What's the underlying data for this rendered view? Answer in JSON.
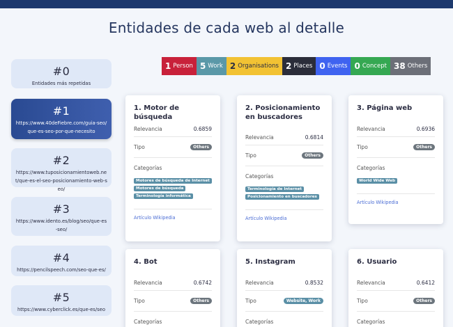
{
  "header": {
    "title": "Entidades de cada web al detalle"
  },
  "colors": {
    "topbar": "#1e3a6e",
    "person": "#c8213a",
    "work": "#5a98a8",
    "organisations": "#f2c233",
    "places": "#2b2d3a",
    "events": "#3f63f0",
    "concept": "#35a852",
    "others": "#6c6f78"
  },
  "stats": [
    {
      "num": "1",
      "label": "Person"
    },
    {
      "num": "5",
      "label": "Work"
    },
    {
      "num": "2",
      "label": "Organisations"
    },
    {
      "num": "2",
      "label": "Places"
    },
    {
      "num": "0",
      "label": "Events"
    },
    {
      "num": "0",
      "label": "Concept"
    },
    {
      "num": "38",
      "label": "Others"
    }
  ],
  "sidebar": {
    "items": [
      {
        "num": "#0",
        "text": "Entidades más repetidas"
      },
      {
        "num": "#1",
        "text": "https://www.40deFiebre.com/guia-seo/que-es-seo-por-que-necesito"
      },
      {
        "num": "#2",
        "text": "https://www.tuposicionamientoweb.net/que-es-el-seo-posicionamiento-web-seo/"
      },
      {
        "num": "#3",
        "text": "https://www.idento.es/blog/seo/que-es-seo/"
      },
      {
        "num": "#4",
        "text": "https://pencilspeech.com/seo-que-es/"
      },
      {
        "num": "#5",
        "text": "https://www.cyberclick.es/que-es/seo"
      }
    ]
  },
  "labels": {
    "relevance": "Relevancia",
    "type": "Tipo",
    "categories": "Categorías",
    "wiki": "Artículo Wikipedia"
  },
  "cards": [
    {
      "title": "1. Motor de búsqueda",
      "relevance": "0.6859",
      "type": "Others",
      "tags": [
        "Motores de búsqueda de Internet",
        "Motores de búsqueda",
        "Terminología informática"
      ]
    },
    {
      "title": "2. Posicionamiento en buscadores",
      "relevance": "0.6814",
      "type": "Others",
      "tags": [
        "Terminología de Internet",
        "Posicionamiento en buscadores"
      ]
    },
    {
      "title": "3. Página web",
      "relevance": "0.6936",
      "type": "Others",
      "tags": [
        "World Wide Web"
      ]
    },
    {
      "title": "4. Bot",
      "relevance": "0.6742",
      "type": "Others"
    },
    {
      "title": "5. Instagram",
      "relevance": "0.8532",
      "type": "Website, Work"
    },
    {
      "title": "6. Usuario",
      "relevance": "0.6412",
      "type": "Others"
    }
  ]
}
